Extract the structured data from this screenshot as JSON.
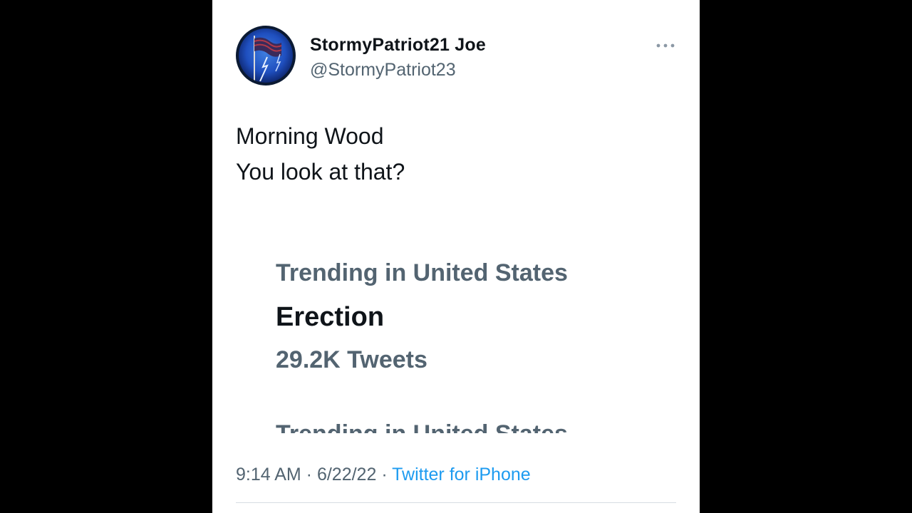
{
  "tweet": {
    "display_name": "StormyPatriot21 Joe",
    "handle": "@StormyPatriot23",
    "text_lines": [
      "Morning Wood",
      "You look at that?"
    ],
    "more_icon": "ellipsis-icon",
    "avatar_icon": "flag-lightning-avatar"
  },
  "trend_image": {
    "heading": "Trending in United States",
    "topic": "Erection",
    "count": "29.2K Tweets",
    "cutoff_next_heading": "Trending in United States"
  },
  "meta": {
    "time": "9:14 AM",
    "separator": " · ",
    "date": "6/22/22",
    "source": "Twitter for iPhone"
  },
  "colors": {
    "background": "#000000",
    "card": "#ffffff",
    "primary_text": "#0f1419",
    "secondary_text": "#536471",
    "link": "#1d9bf0"
  }
}
